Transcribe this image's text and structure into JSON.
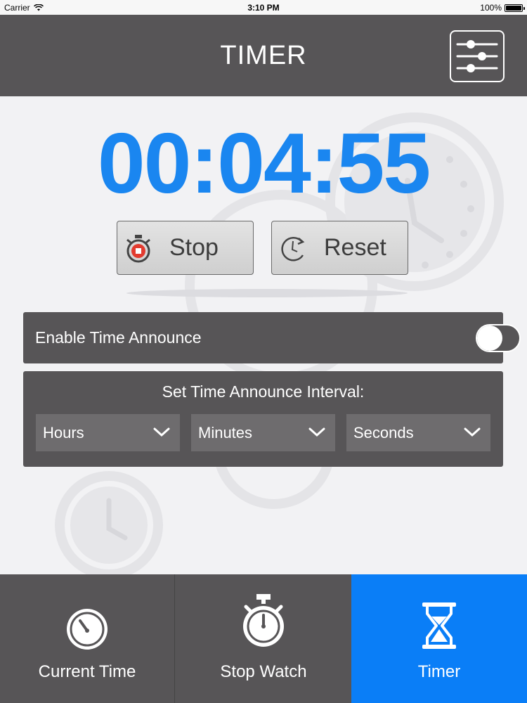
{
  "status_bar": {
    "carrier": "Carrier",
    "time": "3:10 PM",
    "battery": "100%"
  },
  "nav": {
    "title": "TIMER",
    "settings_icon": "sliders-icon"
  },
  "timer": {
    "display": "00:04:55"
  },
  "controls": {
    "stop_label": "Stop",
    "reset_label": "Reset"
  },
  "announce": {
    "label": "Enable Time Announce",
    "enabled": false
  },
  "interval": {
    "title": "Set Time Announce Interval:",
    "hours": "Hours",
    "minutes": "Minutes",
    "seconds": "Seconds"
  },
  "tabs": [
    {
      "label": "Current Time",
      "icon": "clock-icon",
      "active": false
    },
    {
      "label": "Stop Watch",
      "icon": "stopwatch-icon",
      "active": false
    },
    {
      "label": "Timer",
      "icon": "hourglass-icon",
      "active": true
    }
  ],
  "colors": {
    "accent": "#1a86f0",
    "bar": "#575557",
    "active_tab": "#0a7ef7"
  }
}
